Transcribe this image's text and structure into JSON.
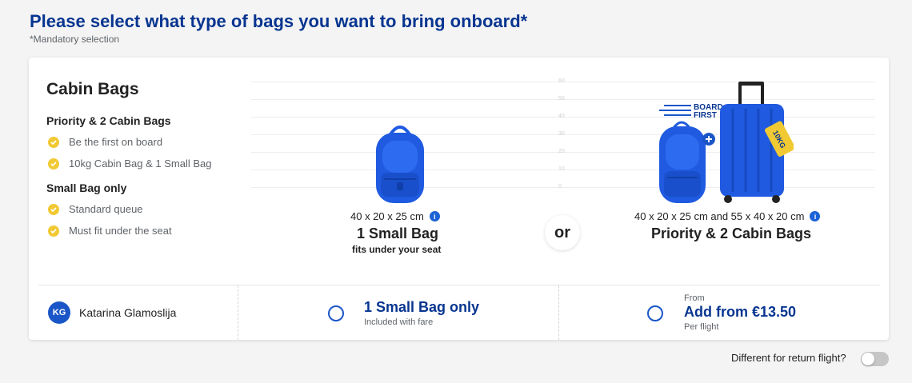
{
  "header": {
    "title": "Please select what type of bags you want to bring onboard*",
    "subtitle": "*Mandatory selection"
  },
  "cabin": {
    "title": "Cabin Bags",
    "options": [
      {
        "heading": "Priority & 2 Cabin Bags",
        "features": [
          "Be the first on board",
          "10kg Cabin Bag & 1 Small Bag"
        ]
      },
      {
        "heading": "Small Bag only",
        "features": [
          "Standard queue",
          "Must fit under the seat"
        ]
      }
    ]
  },
  "ruler_labels": [
    "60",
    "50",
    "40",
    "30",
    "20",
    "10",
    "0"
  ],
  "small_bag": {
    "dimensions": "40 x 20 x 25 cm",
    "name": "1 Small Bag",
    "note": "fits under your seat"
  },
  "or_label": "or",
  "priority_bag": {
    "dimensions": "40 x 20 x 25 cm and 55 x 40 x 20 cm",
    "name": "Priority & 2 Cabin Bags",
    "board_first_line1": "BOARD",
    "board_first_line2": "FIRST",
    "tag_text": "10KG"
  },
  "info_glyph": "i",
  "passenger": {
    "initials": "KG",
    "name": "Katarina Glamoslija"
  },
  "option_small": {
    "label": "1 Small Bag only",
    "sub": "Included with fare"
  },
  "option_priority": {
    "from": "From",
    "label": "Add from €13.50",
    "sub": "Per flight"
  },
  "return_toggle": {
    "label": "Different for return flight?",
    "on": false
  },
  "colors": {
    "brand_navy": "#073590",
    "accent_blue": "#1a56c7",
    "check_yellow": "#f1c933",
    "bag_blue": "#1f5ae0"
  }
}
